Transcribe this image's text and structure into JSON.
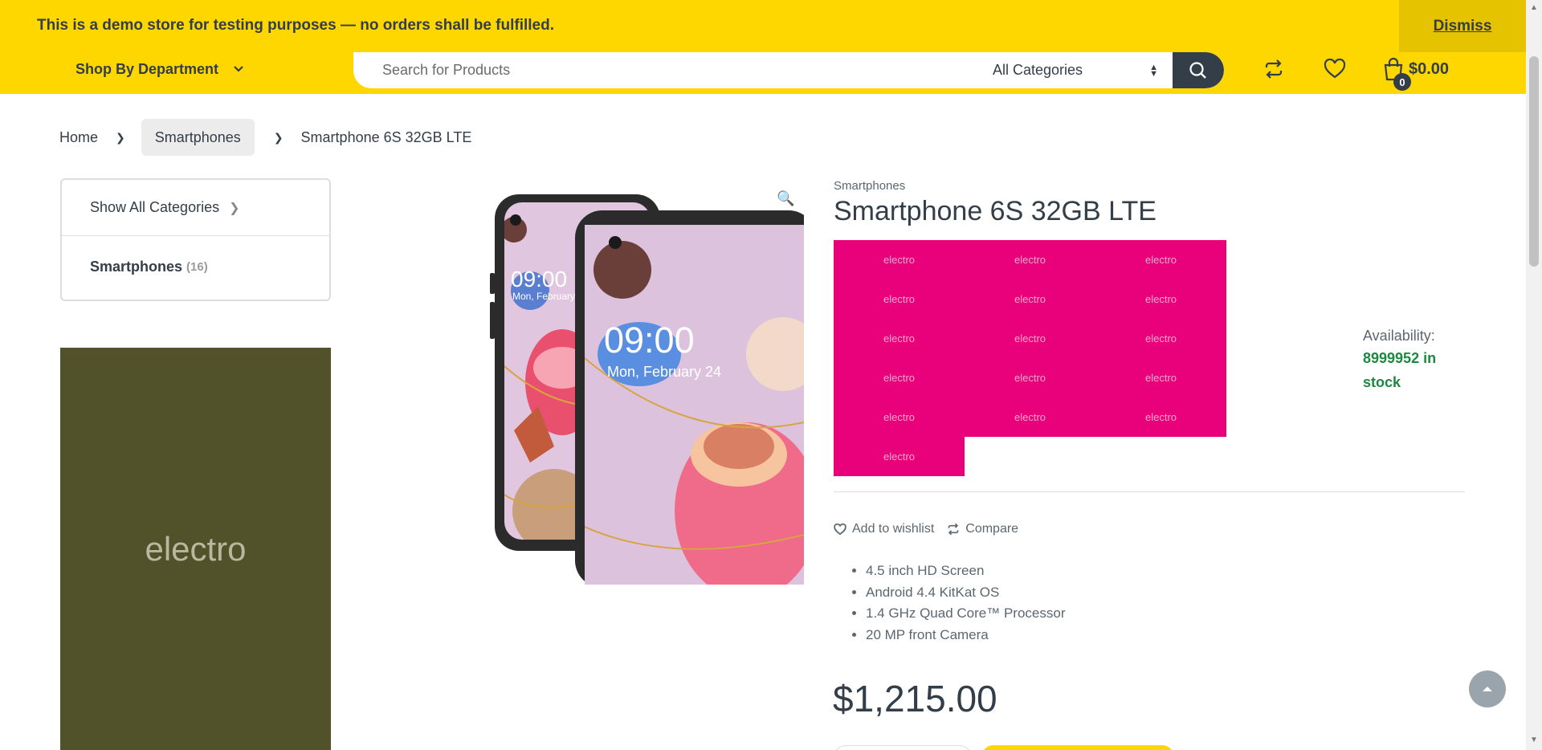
{
  "notice": {
    "text": "This is a demo store for testing purposes — no orders shall be fulfilled.",
    "dismiss_label": "Dismiss"
  },
  "header": {
    "department_label": "Shop By Department",
    "search_placeholder": "Search for Products",
    "category_selected": "All Categories",
    "cart_count": "0",
    "cart_total": "$0.00"
  },
  "breadcrumb": {
    "home": "Home",
    "category": "Smartphones",
    "current": "Smartphone 6S 32GB LTE"
  },
  "sidebar": {
    "show_all": "Show All Categories",
    "category": "Smartphones",
    "category_count": "(16)",
    "banner_text": "electro"
  },
  "product": {
    "category": "Smartphones",
    "title": "Smartphone 6S 32GB LTE",
    "brand_tiles": [
      "electro",
      "electro",
      "electro",
      "electro",
      "electro",
      "electro",
      "electro",
      "electro",
      "electro",
      "electro",
      "electro",
      "electro",
      "electro",
      "electro",
      "electro",
      "electro"
    ],
    "availability_label": "Availability:",
    "availability_value": "8999952 in stock",
    "wishlist_label": "Add to wishlist",
    "compare_label": "Compare",
    "features": [
      "4.5 inch HD Screen",
      "Android 4.4 KitKat OS",
      "1.4 GHz Quad Core™ Processor",
      "20 MP front Camera"
    ],
    "price": "$1,215.00",
    "image": {
      "time_back": "09:00",
      "date_back": "Mon, February",
      "time_front": "09:00",
      "date_front": "Mon, February 24"
    }
  },
  "colors": {
    "brand_yellow": "#fed700",
    "dark": "#333e48",
    "tile_pink": "#e8017a",
    "stock_green": "#1a8a3e"
  }
}
